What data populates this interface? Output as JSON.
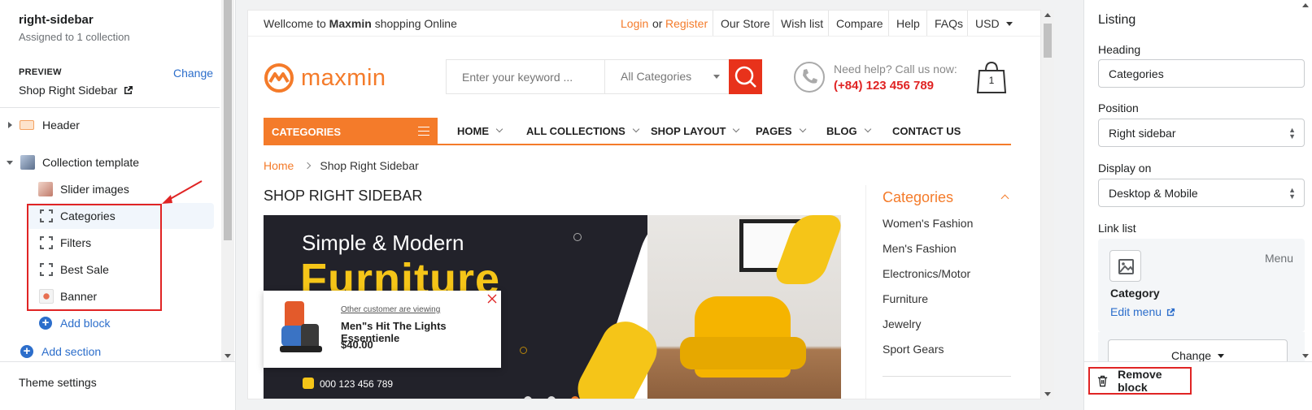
{
  "left_panel": {
    "title": "right-sidebar",
    "assigned": "Assigned to 1 collection",
    "preview_label": "PREVIEW",
    "change_link": "Change",
    "preview_value": "Shop Right Sidebar",
    "sections": {
      "header": "Header",
      "collection_template": "Collection template",
      "slider_images": "Slider images",
      "categories": "Categories",
      "filters": "Filters",
      "best_sale": "Best Sale",
      "banner": "Banner",
      "add_block": "Add block",
      "add_section": "Add section"
    },
    "theme_settings": "Theme settings"
  },
  "store": {
    "topbar": {
      "welcome_prefix": "Wellcome to",
      "welcome_brand": "Maxmin",
      "welcome_suffix": "shopping Online",
      "login": "Login",
      "or": "or",
      "register": "Register",
      "links": [
        "Our Store",
        "Wish list",
        "Compare",
        "Help",
        "FAQs"
      ],
      "currency": "USD"
    },
    "logo_text": "maxmin",
    "search": {
      "placeholder": "Enter your keyword ...",
      "category": "All Categories"
    },
    "help": {
      "line1": "Need help? Call us now:",
      "phone": "(+84) 123 456 789"
    },
    "cart_count": "1",
    "nav": {
      "categories": "CATEGORIES",
      "items": [
        "HOME",
        "ALL COLLECTIONS",
        "SHOP LAYOUT",
        "PAGES",
        "BLOG",
        "CONTACT US"
      ]
    },
    "breadcrumb": {
      "home": "Home",
      "current": "Shop Right Sidebar"
    },
    "page_heading": "SHOP RIGHT SIDEBAR",
    "banner": {
      "line1": "Simple & Modern",
      "line2": "Furniture",
      "phone": "000 123 456 789"
    },
    "popup": {
      "viewing": "Other customer are viewing",
      "product": "Men\"s Hit The Lights Essentienle",
      "price": "$40.00"
    },
    "sidebar": {
      "title": "Categories",
      "items": [
        "Women's Fashion",
        "Men's Fashion",
        "Electronics/Motor",
        "Furniture",
        "Jewelry",
        "Sport Gears"
      ]
    }
  },
  "right_panel": {
    "title": "Listing",
    "heading_label": "Heading",
    "heading_value": "Categories",
    "position_label": "Position",
    "position_value": "Right sidebar",
    "display_label": "Display on",
    "display_value": "Desktop & Mobile",
    "link_list_label": "Link list",
    "menu_tag": "Menu",
    "category_name": "Category",
    "edit_menu": "Edit menu",
    "change_button": "Change",
    "remove_block": "Remove block"
  },
  "colors": {
    "brand_orange": "#f47b2a",
    "red": "#e02424",
    "shopify_blue": "#2c6ecb",
    "search_button": "#e8321b"
  }
}
